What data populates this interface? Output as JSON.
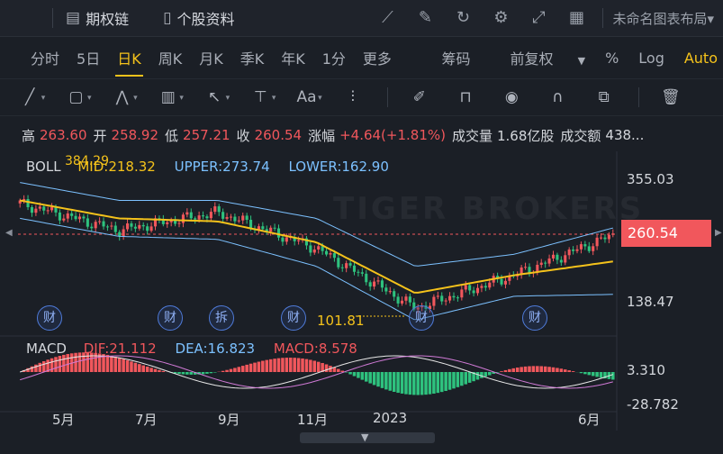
{
  "toolbar": {
    "option_chain": "期权链",
    "stock_profile": "个股资料",
    "layout_name": "未命名图表布局"
  },
  "periods": [
    "分时",
    "5日",
    "日K",
    "周K",
    "月K",
    "季K",
    "年K",
    "1分",
    "更多"
  ],
  "active_period": "日K",
  "period_right": {
    "chips": "筹码",
    "adjust": "前复权",
    "percent": "%",
    "log": "Log",
    "auto": "Auto"
  },
  "quote": {
    "high_label": "高",
    "high": "263.60",
    "open_label": "开",
    "open": "258.92",
    "low_label": "低",
    "low": "257.21",
    "close_label": "收",
    "close": "260.54",
    "change_label": "涨幅",
    "change": "+4.64(+1.81%)",
    "volume_label": "成交量",
    "volume": "1.68亿股",
    "turnover_label": "成交额",
    "turnover": "438..."
  },
  "boll_legend": {
    "name": "BOLL",
    "mid": "MID:218.32",
    "upper": "UPPER:273.74",
    "lower": "LOWER:162.90"
  },
  "macd_legend": {
    "name": "MACD",
    "dif": "DIF:21.112",
    "dea": "DEA:16.823",
    "macd": "MACD:8.578"
  },
  "price_axis": {
    "top": "355.03",
    "bottom": "138.47",
    "last": "260.54"
  },
  "macd_axis": {
    "top": "3.310",
    "bottom": "-28.782"
  },
  "annotations": {
    "max": "384.29",
    "min": "101.81"
  },
  "x_labels": [
    "5月",
    "7月",
    "9月",
    "11月",
    "2023",
    "6月"
  ],
  "events": [
    "财",
    "财",
    "拆",
    "财",
    "财",
    "财"
  ],
  "watermark": "TIGER BROKERS",
  "colors": {
    "up": "#f1575c",
    "down": "#2ec27e",
    "accent": "#f4c21b",
    "band": "#7cc1ff",
    "background": "#1b1f26"
  },
  "chart_data": {
    "type": "candlestick",
    "x": [
      "5月",
      "7月",
      "9月",
      "11月",
      "2023",
      "6月"
    ],
    "close_trend": [
      315,
      270,
      300,
      240,
      140,
      195,
      262
    ],
    "mid_trend": [
      320,
      290,
      285,
      250,
      165,
      195,
      218
    ],
    "upper_trend": [
      350,
      320,
      320,
      290,
      210,
      230,
      274
    ],
    "lower_trend": [
      290,
      260,
      255,
      210,
      120,
      160,
      163
    ],
    "ylim": [
      101,
      390
    ],
    "last_price": 260.54,
    "macd_ylim": [
      -28.782,
      3.31
    ]
  }
}
